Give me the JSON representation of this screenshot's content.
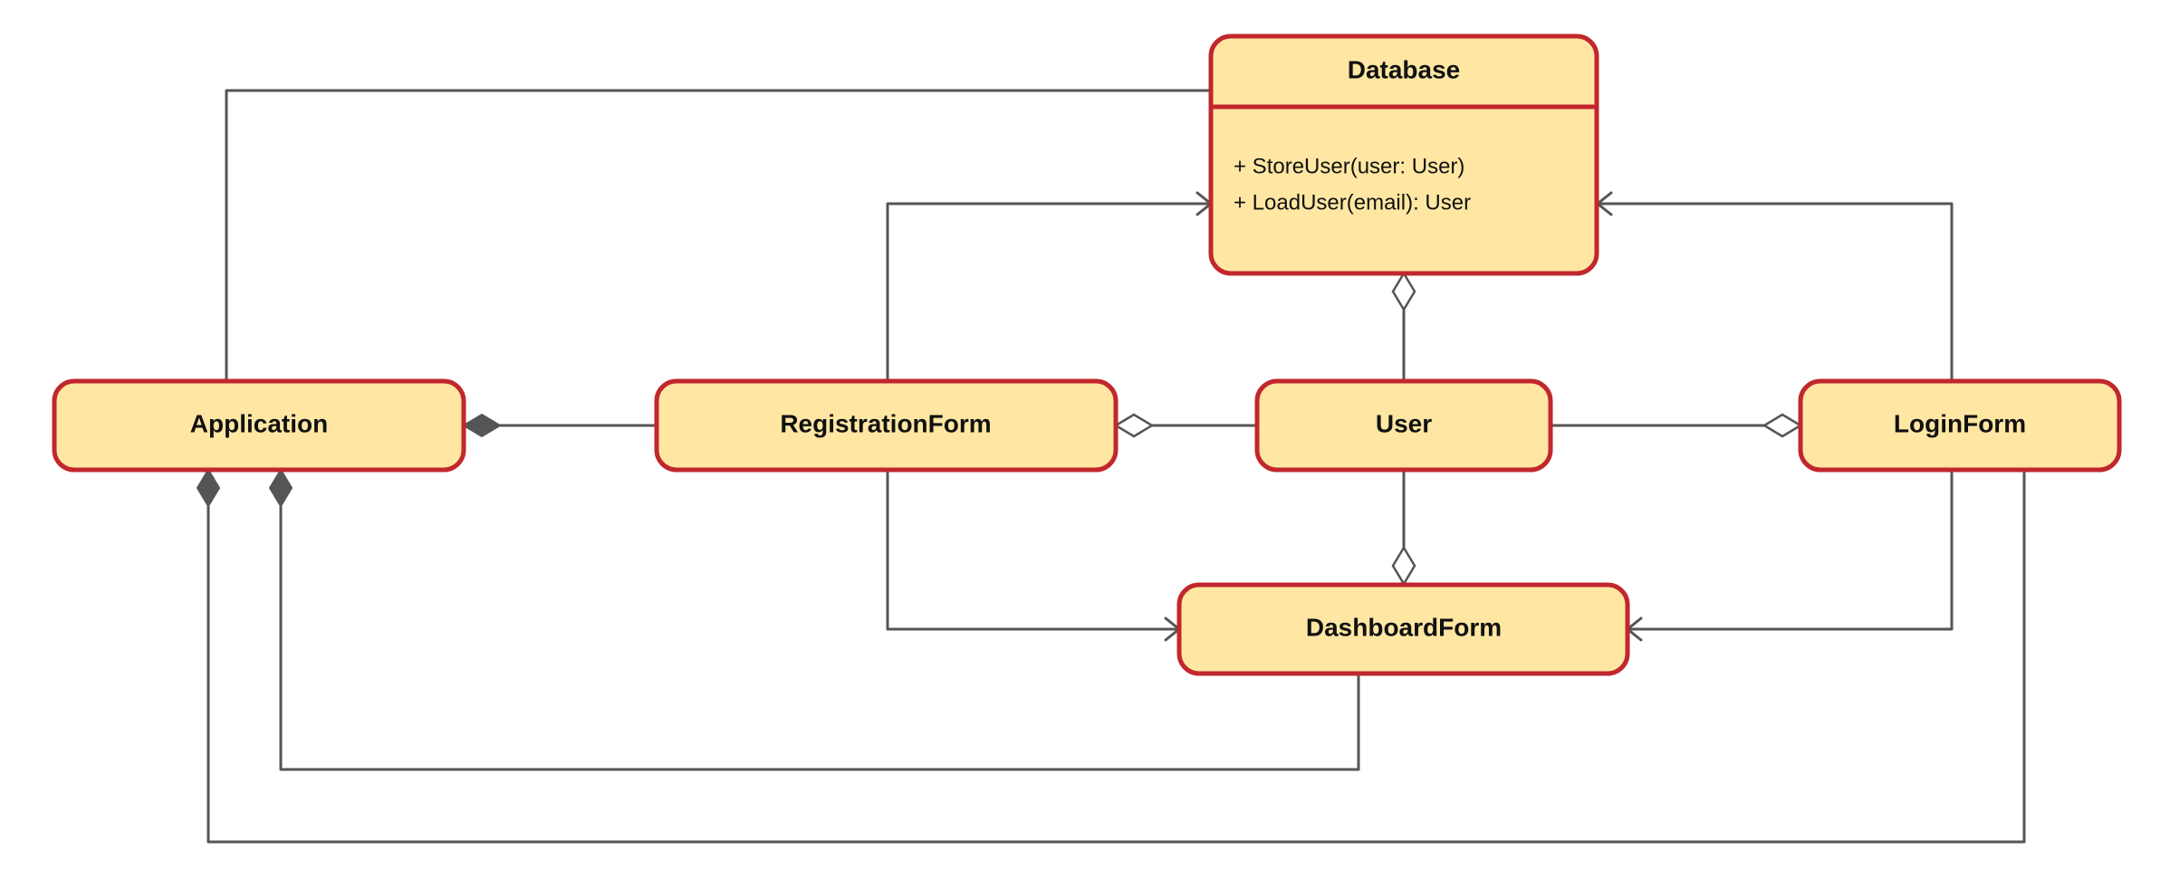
{
  "classes": {
    "application": {
      "name": "Application"
    },
    "database": {
      "name": "Database",
      "methods": [
        "+ StoreUser(user: User)",
        "+ LoadUser(email): User"
      ]
    },
    "registrationForm": {
      "name": "RegistrationForm"
    },
    "user": {
      "name": "User"
    },
    "loginForm": {
      "name": "LoginForm"
    },
    "dashboardForm": {
      "name": "DashboardForm"
    }
  },
  "relationships": [
    {
      "from": "Application",
      "to": "Database",
      "type": "composition"
    },
    {
      "from": "Application",
      "to": "RegistrationForm",
      "type": "composition"
    },
    {
      "from": "Application",
      "to": "DashboardForm",
      "type": "composition"
    },
    {
      "from": "Application",
      "to": "LoginForm",
      "type": "composition"
    },
    {
      "from": "RegistrationForm",
      "to": "User",
      "type": "aggregation"
    },
    {
      "from": "LoginForm",
      "to": "User",
      "type": "aggregation"
    },
    {
      "from": "Database",
      "to": "User",
      "type": "aggregation"
    },
    {
      "from": "DashboardForm",
      "to": "User",
      "type": "aggregation"
    },
    {
      "from": "RegistrationForm",
      "to": "Database",
      "type": "dependency"
    },
    {
      "from": "LoginForm",
      "to": "Database",
      "type": "dependency"
    },
    {
      "from": "RegistrationForm",
      "to": "DashboardForm",
      "type": "dependency"
    },
    {
      "from": "LoginForm",
      "to": "DashboardForm",
      "type": "dependency"
    }
  ]
}
